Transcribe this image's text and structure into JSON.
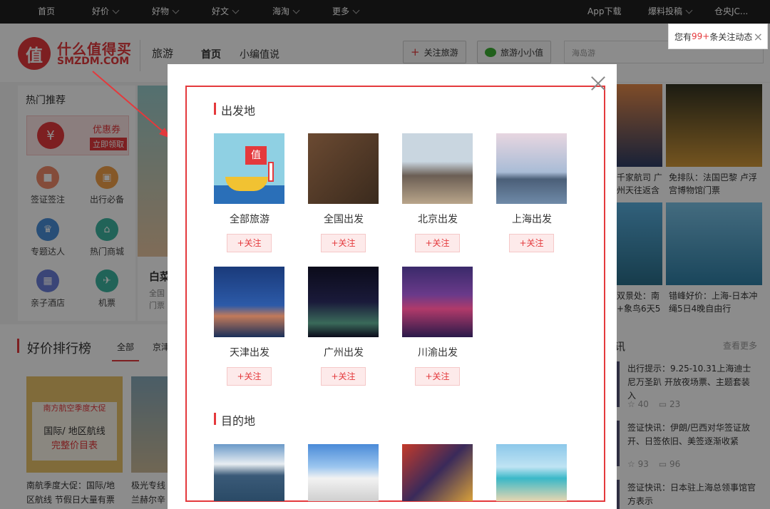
{
  "topnav": {
    "items": [
      {
        "label": "首页",
        "dropdown": false
      },
      {
        "label": "好价",
        "dropdown": true
      },
      {
        "label": "好物",
        "dropdown": true
      },
      {
        "label": "好文",
        "dropdown": true
      },
      {
        "label": "海淘",
        "dropdown": true
      },
      {
        "label": "更多",
        "dropdown": true
      }
    ],
    "right": [
      {
        "label": "App下载",
        "dropdown": false
      },
      {
        "label": "爆料投稿",
        "dropdown": true
      },
      {
        "label": "仓央JC...",
        "dropdown": true
      }
    ]
  },
  "notification": {
    "prefix": "您有",
    "count": "99+",
    "suffix": "条关注动态"
  },
  "header": {
    "logo_icon": "值",
    "logo_title": "什么值得买",
    "logo_domain": "SMZDM.COM",
    "section": "旅游",
    "nav": [
      "首页",
      "小编值说"
    ],
    "follow_button": "关注旅游",
    "wechat_button": "旅游小小值",
    "search_placeholder": "海岛游"
  },
  "sidebar": {
    "title": "热门推荐",
    "coupon_title": "优惠券",
    "coupon_action": "立即领取",
    "items": [
      {
        "label": "签证签注",
        "icon": "visa-icon",
        "color": "#f08b6b"
      },
      {
        "label": "出行必备",
        "icon": "luggage-icon",
        "color": "#f3a14a"
      },
      {
        "label": "专题达人",
        "icon": "crown-icon",
        "color": "#4a8fd9"
      },
      {
        "label": "热门商城",
        "icon": "shop-icon",
        "color": "#3cb5a0"
      },
      {
        "label": "亲子酒店",
        "icon": "hotel-icon",
        "color": "#6b7fd9"
      },
      {
        "label": "机票",
        "icon": "plane-icon",
        "color": "#3cb5a0"
      }
    ]
  },
  "feature": {
    "title": "白菜",
    "text1": "全国",
    "text2": "门票"
  },
  "ranking": {
    "title": "好价排行榜",
    "tabs": [
      "全部",
      "京津"
    ],
    "cards": [
      {
        "banner_title": "南方航空季度大促",
        "banner_body": "国际/ 地区航线",
        "banner_sub": "完整价目表",
        "caption": "南航季度大促：国际/地区航线 节假日大量有票"
      },
      {
        "caption": "极光专线 兰赫尔辛"
      }
    ]
  },
  "right_grid": [
    {
      "caption": "千家航司 广州天往返含"
    },
    {
      "caption": "免排队：法国巴黎 卢浮宫博物馆门票"
    },
    {
      "caption": "双景处：南+象鸟6天5"
    },
    {
      "caption": "错峰好价：上海-日本冲绳5日4晚自由行"
    }
  ],
  "news": {
    "header_fragment": "讯",
    "more": "查看更多",
    "items": [
      {
        "text": "出行提示：9.25-10.31上海迪士尼万圣趴 开放夜场票、主题套装入",
        "stars": "40",
        "comments": "23"
      },
      {
        "text": "签证快讯：伊朗/巴西对华签证放开、日签依旧、美签逐渐收紧",
        "stars": "93",
        "comments": "96"
      },
      {
        "text": "签证快讯：日本驻上海总领事馆官方表示",
        "stars": "",
        "comments": ""
      }
    ]
  },
  "modal": {
    "departure_title": "出发地",
    "destination_title": "目的地",
    "follow_label": "+关注",
    "departures": [
      {
        "name": "全部旅游"
      },
      {
        "name": "全国出发"
      },
      {
        "name": "北京出发"
      },
      {
        "name": "上海出发"
      },
      {
        "name": "天津出发"
      },
      {
        "name": "广州出发"
      },
      {
        "name": "川渝出发"
      }
    ],
    "destinations": [
      {
        "image": "mount-fuji"
      },
      {
        "image": "taj-mahal"
      },
      {
        "image": "city-street"
      },
      {
        "image": "tropical-beach"
      }
    ]
  }
}
